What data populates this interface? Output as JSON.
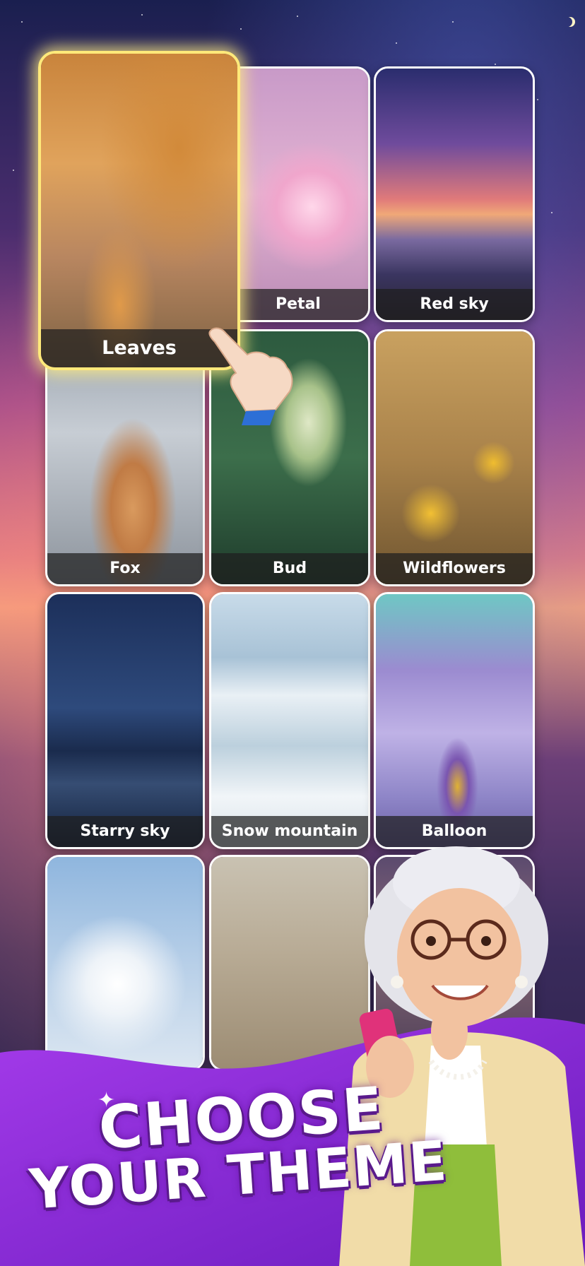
{
  "themes": [
    {
      "label": "Leaves",
      "selected": true
    },
    {
      "label": "Petal"
    },
    {
      "label": "Red sky"
    },
    {
      "label": "Fox"
    },
    {
      "label": "Bud"
    },
    {
      "label": "Wildflowers"
    },
    {
      "label": "Starry sky"
    },
    {
      "label": "Snow mountain"
    },
    {
      "label": "Balloon"
    },
    {
      "label": ""
    },
    {
      "label": ""
    },
    {
      "label": ""
    }
  ],
  "headline": {
    "line1": "CHOOSE",
    "line2": "YOUR THEME"
  },
  "colors": {
    "selected_border": "#ffe97a",
    "banner_purple": "#9b2fe0",
    "label_bg": "#1e1e1e"
  }
}
